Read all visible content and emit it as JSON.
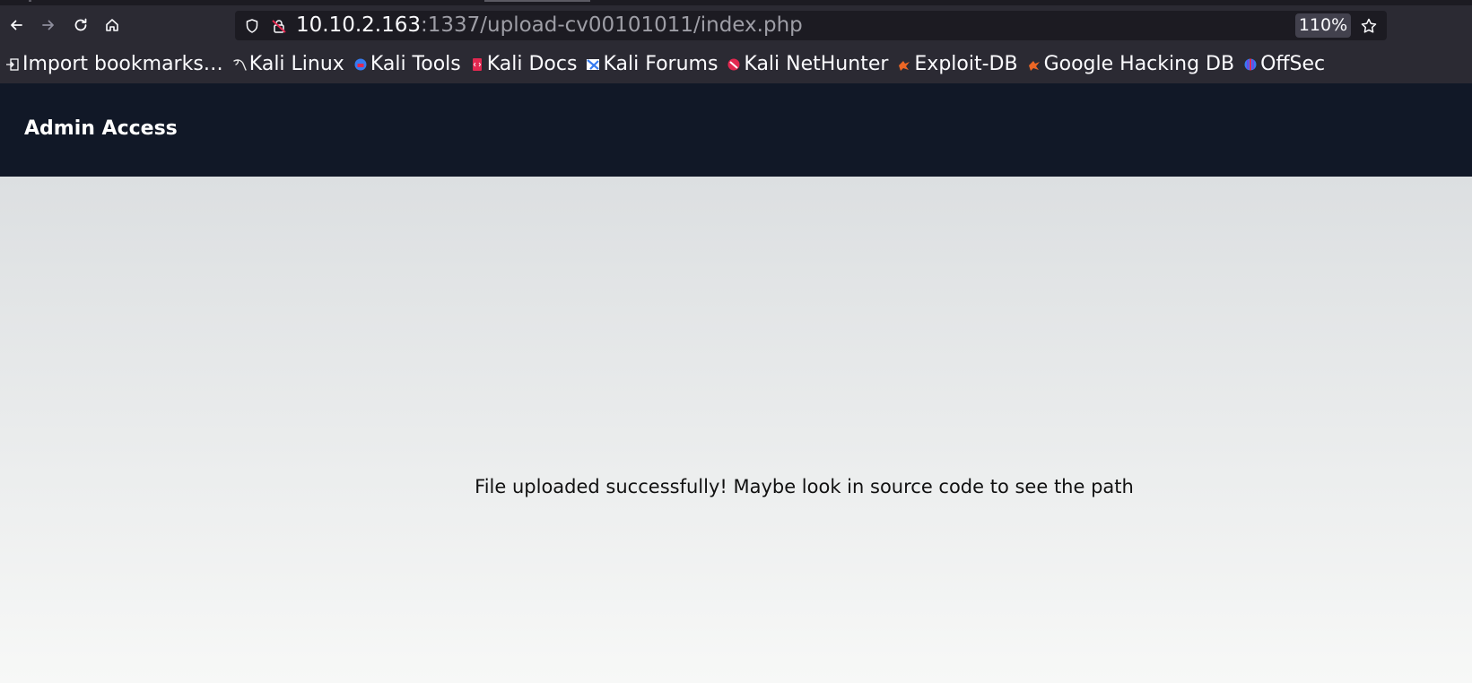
{
  "browser": {
    "nav": {
      "back_icon": "arrow-left-icon",
      "forward_icon": "arrow-right-icon",
      "reload_icon": "reload-icon",
      "home_icon": "home-icon"
    },
    "url_bar": {
      "host": "10.10.2.163",
      "path": ":1337/upload-cv00101011/index.php",
      "zoom": "110%"
    },
    "bookmarks": [
      {
        "label": "Import bookmarks…",
        "icon": "import-icon"
      },
      {
        "label": "Kali Linux",
        "icon": "kali-dragon-icon"
      },
      {
        "label": "Kali Tools",
        "icon": "kali-tools-icon"
      },
      {
        "label": "Kali Docs",
        "icon": "kali-docs-icon"
      },
      {
        "label": "Kali Forums",
        "icon": "kali-forums-icon"
      },
      {
        "label": "Kali NetHunter",
        "icon": "kali-nethunter-icon"
      },
      {
        "label": "Exploit-DB",
        "icon": "exploit-db-icon"
      },
      {
        "label": "Google Hacking DB",
        "icon": "ghdb-icon"
      },
      {
        "label": "OffSec",
        "icon": "offsec-icon"
      }
    ]
  },
  "page": {
    "brand": "Admin Access",
    "message": "File uploaded successfully! Maybe look in source code to see the path"
  },
  "colors": {
    "chrome_bg": "#2b2a33",
    "url_bg": "#1c1b22",
    "header_bg": "#111827",
    "content_top": "#dcdfe1",
    "content_bottom": "#f7f8f7"
  }
}
